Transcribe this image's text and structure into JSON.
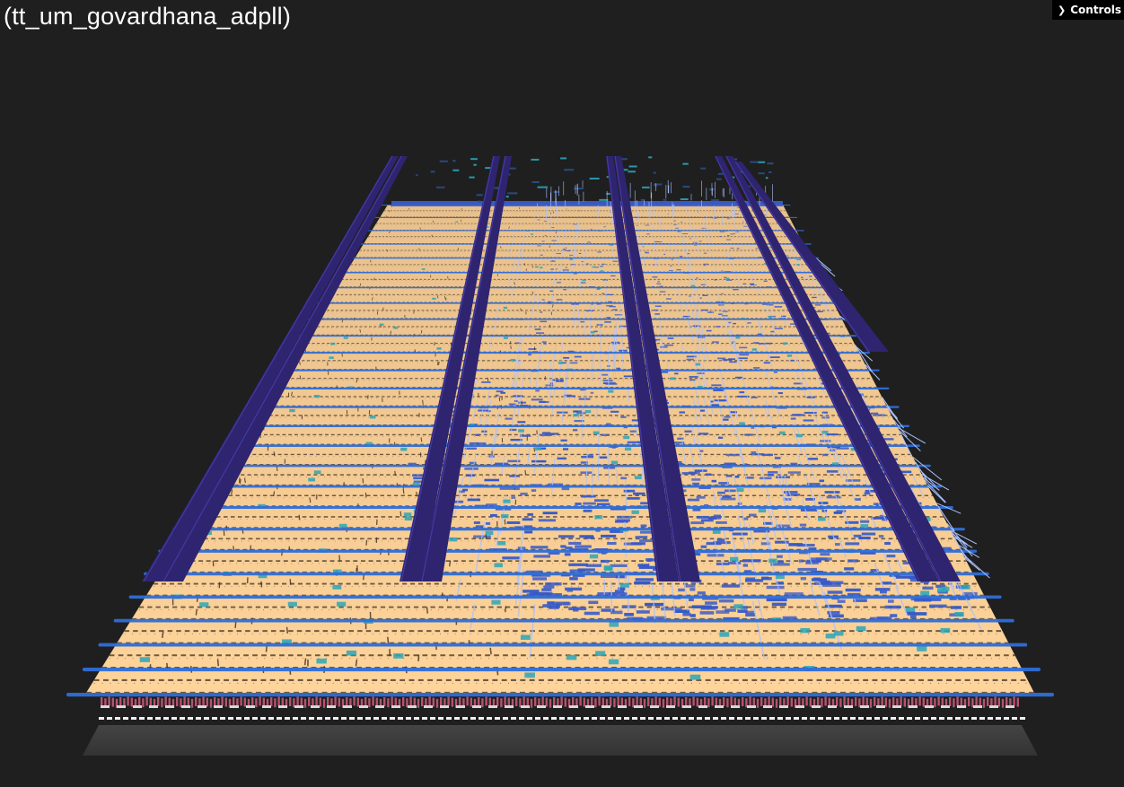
{
  "title": "(tt_um_govardhana_adpll)",
  "controls": {
    "label": "Controls",
    "expanded": false
  },
  "icons": {
    "controls_chevron": "chevron-right-icon"
  },
  "colors": {
    "background": "#1f1f1f",
    "substrate": "#3a3a3a",
    "cell_body": "#f6c98c",
    "cell_tap": "#c45a78",
    "metal_stripe": "#2f6ed8",
    "power_strap": "#2e2470",
    "via_cyan": "#2aa6b8",
    "signal_wire": "#a9c2ff",
    "dense_route": "#3559c9"
  }
}
